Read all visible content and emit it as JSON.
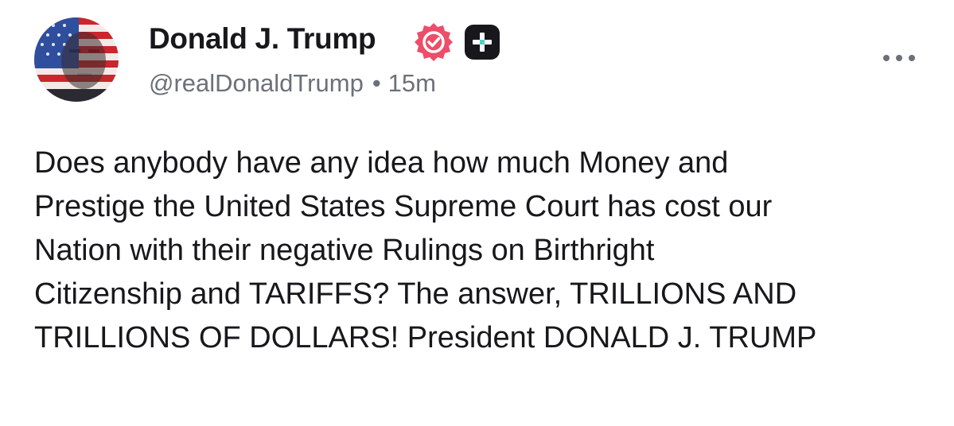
{
  "author": {
    "display_name": "Donald J. Trump",
    "handle": "@realDonaldTrump",
    "separator": "•",
    "time_ago": "15m",
    "verified_icon": "verified-badge-icon",
    "plus_icon": "plus-badge-icon"
  },
  "menu": {
    "icon": "more-options-icon"
  },
  "post": {
    "lines": [
      "Does anybody have any idea how much Money and",
      "Prestige the United States Supreme Court has cost our",
      "Nation with their negative Rulings on Birthright",
      "Citizenship and TARIFFS? The answer, TRILLIONS AND",
      "TRILLIONS OF DOLLARS! President DONALD J. TRUMP"
    ]
  },
  "colors": {
    "text": "#17171c",
    "muted": "#6c7079",
    "verified": "#ec4e6a",
    "plus_badge": "#17171c",
    "plus_accent": "#4fd1c5"
  }
}
